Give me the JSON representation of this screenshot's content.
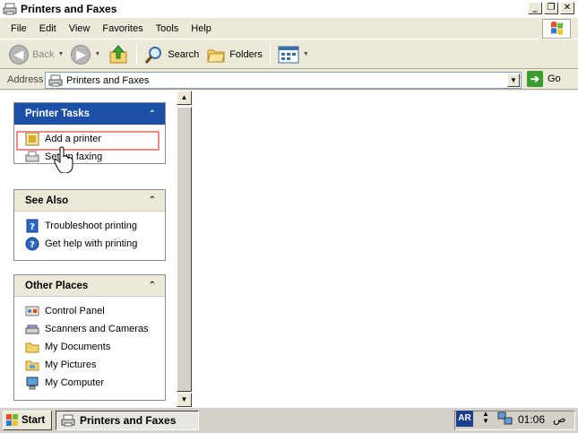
{
  "window": {
    "title": "Printers and Faxes",
    "buttons": {
      "minimize": "_",
      "restore": "❐",
      "close": "✕"
    }
  },
  "menu": [
    "File",
    "Edit",
    "View",
    "Favorites",
    "Tools",
    "Help"
  ],
  "toolbar": {
    "back_label": "Back",
    "search_label": "Search",
    "folders_label": "Folders"
  },
  "address": {
    "label": "Address",
    "value": "Printers and Faxes",
    "go_label": "Go"
  },
  "panels": {
    "printer_tasks": {
      "title": "Printer Tasks",
      "items": [
        "Add a printer",
        "Set up faxing"
      ]
    },
    "see_also": {
      "title": "See Also",
      "items": [
        "Troubleshoot printing",
        "Get help with printing"
      ]
    },
    "other_places": {
      "title": "Other Places",
      "items": [
        "Control Panel",
        "Scanners and Cameras",
        "My Documents",
        "My Pictures",
        "My Computer"
      ]
    }
  },
  "taskbar": {
    "start_label": "Start",
    "task_label": "Printers and Faxes",
    "lang": "AR",
    "clock": "01:06",
    "ampm": "ص"
  },
  "colors": {
    "accent_blue": "#1c4fa7",
    "highlight": "#e88a8a"
  }
}
